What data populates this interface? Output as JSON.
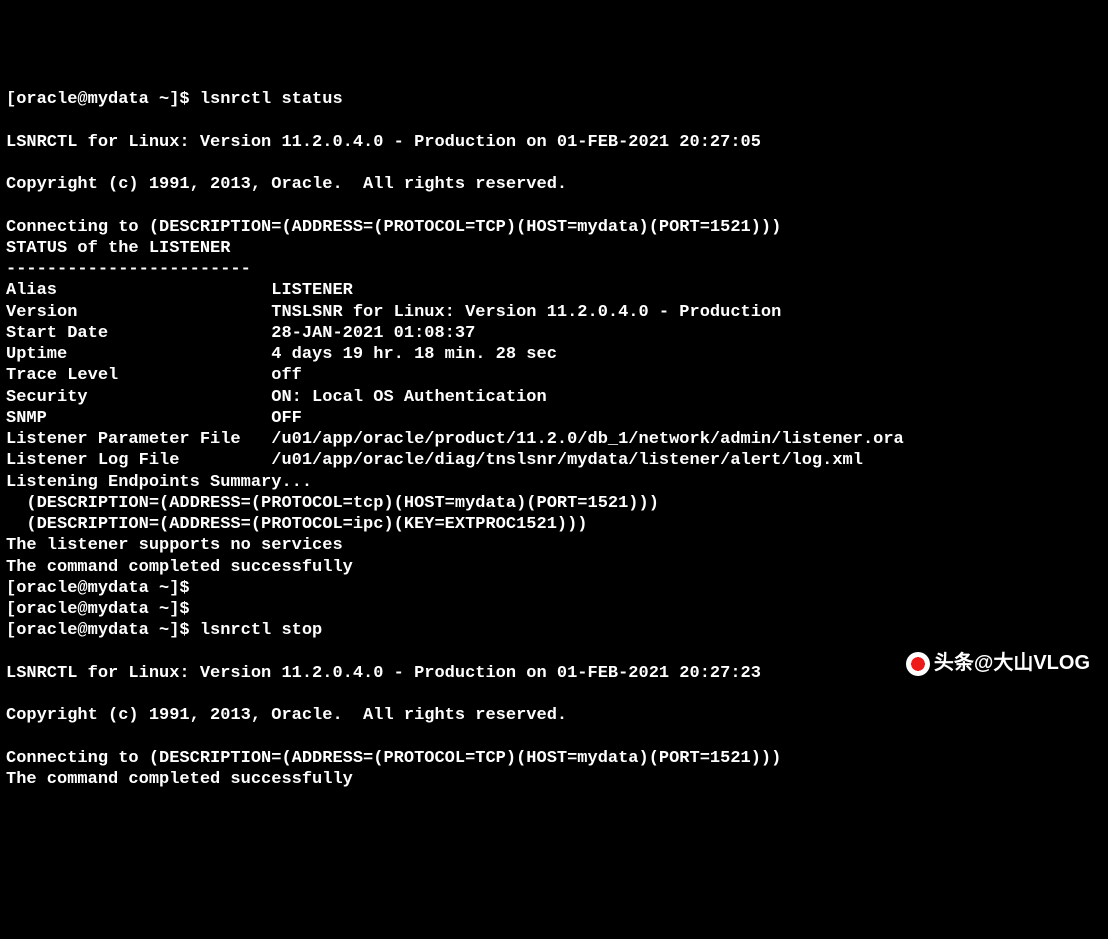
{
  "lines": [
    "[oracle@mydata ~]$ lsnrctl status",
    "",
    "LSNRCTL for Linux: Version 11.2.0.4.0 - Production on 01-FEB-2021 20:27:05",
    "",
    "Copyright (c) 1991, 2013, Oracle.  All rights reserved.",
    "",
    "Connecting to (DESCRIPTION=(ADDRESS=(PROTOCOL=TCP)(HOST=mydata)(PORT=1521)))",
    "STATUS of the LISTENER",
    "------------------------",
    "Alias                     LISTENER",
    "Version                   TNSLSNR for Linux: Version 11.2.0.4.0 - Production",
    "Start Date                28-JAN-2021 01:08:37",
    "Uptime                    4 days 19 hr. 18 min. 28 sec",
    "Trace Level               off",
    "Security                  ON: Local OS Authentication",
    "SNMP                      OFF",
    "Listener Parameter File   /u01/app/oracle/product/11.2.0/db_1/network/admin/listener.ora",
    "Listener Log File         /u01/app/oracle/diag/tnslsnr/mydata/listener/alert/log.xml",
    "Listening Endpoints Summary...",
    "  (DESCRIPTION=(ADDRESS=(PROTOCOL=tcp)(HOST=mydata)(PORT=1521)))",
    "  (DESCRIPTION=(ADDRESS=(PROTOCOL=ipc)(KEY=EXTPROC1521)))",
    "The listener supports no services",
    "The command completed successfully",
    "[oracle@mydata ~]$ ",
    "[oracle@mydata ~]$ ",
    "[oracle@mydata ~]$ lsnrctl stop",
    "",
    "LSNRCTL for Linux: Version 11.2.0.4.0 - Production on 01-FEB-2021 20:27:23",
    "",
    "Copyright (c) 1991, 2013, Oracle.  All rights reserved.",
    "",
    "Connecting to (DESCRIPTION=(ADDRESS=(PROTOCOL=TCP)(HOST=mydata)(PORT=1521)))",
    "The command completed successfully"
  ],
  "watermark": {
    "text": "头条@大山VLOG"
  }
}
